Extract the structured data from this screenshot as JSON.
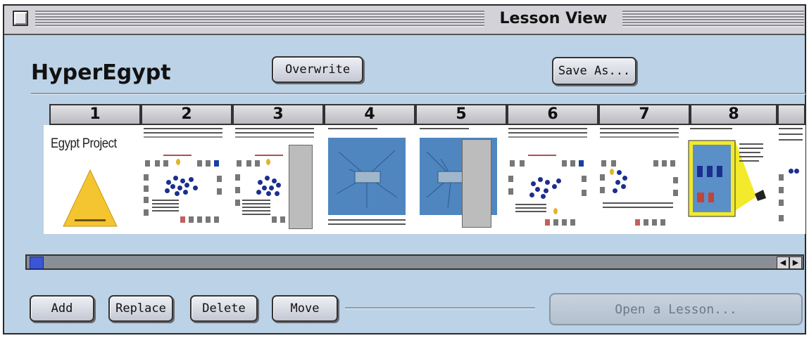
{
  "window": {
    "title": "Lesson View"
  },
  "lesson": {
    "name": "HyperEgypt"
  },
  "toolbar": {
    "overwrite_label": "Overwrite",
    "save_as_label": "Save As..."
  },
  "slides": [
    {
      "number": "1",
      "title": "Egypt Project"
    },
    {
      "number": "2"
    },
    {
      "number": "3"
    },
    {
      "number": "4"
    },
    {
      "number": "5"
    },
    {
      "number": "6"
    },
    {
      "number": "7"
    },
    {
      "number": "8"
    },
    {
      "number": ""
    }
  ],
  "actions": {
    "add_label": "Add",
    "replace_label": "Replace",
    "delete_label": "Delete",
    "move_label": "Move",
    "open_lesson_label": "Open a Lesson..."
  },
  "colors": {
    "window_bg": "#bcd2e6",
    "accent_blue": "#3a56d4",
    "triangle": "#f5c431",
    "concept_map": "#4f86c0"
  }
}
